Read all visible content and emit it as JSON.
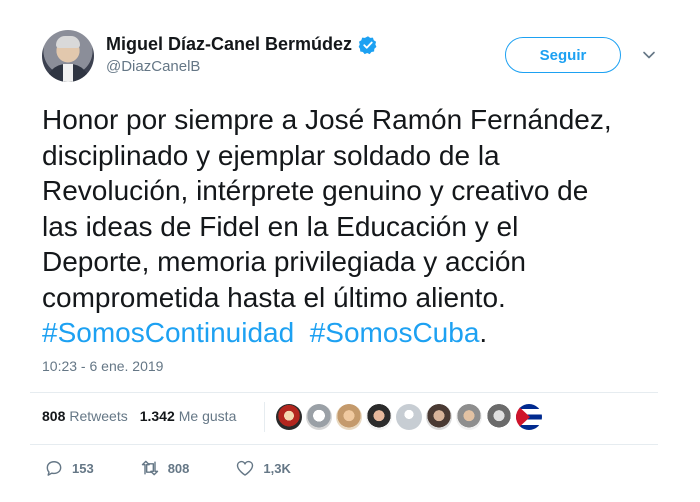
{
  "author": {
    "display_name": "Miguel Díaz-Canel Bermúdez",
    "handle": "@DiazCanelB",
    "verified": true
  },
  "follow_label": "Seguir",
  "tweet": {
    "lines": [
      "Honor por siempre a José Ramón Fernández,",
      "disciplinado y ejemplar soldado de la",
      "Revolución, intérprete genuino y creativo de",
      "las ideas de Fidel en la Educación y el",
      "Deporte, memoria privilegiada y acción",
      "comprometida hasta el último aliento."
    ],
    "hashtag1": "#SomosContinuidad",
    "hashtag2": "#SomosCuba",
    "trailing": "."
  },
  "timestamp": "10:23 - 6 ene. 2019",
  "stats": {
    "retweets_count": "808",
    "retweets_label": "Retweets",
    "likes_count": "1.342",
    "likes_label": "Me gusta"
  },
  "actions": {
    "replies": "153",
    "retweets": "808",
    "likes": "1,3K"
  },
  "colors": {
    "accent": "#1da1f2",
    "text": "#14171a",
    "muted": "#657786",
    "divider": "#e6ecf0"
  },
  "icons": [
    "verified-badge-icon",
    "chevron-down-icon",
    "reply-icon",
    "retweet-icon",
    "like-icon"
  ]
}
